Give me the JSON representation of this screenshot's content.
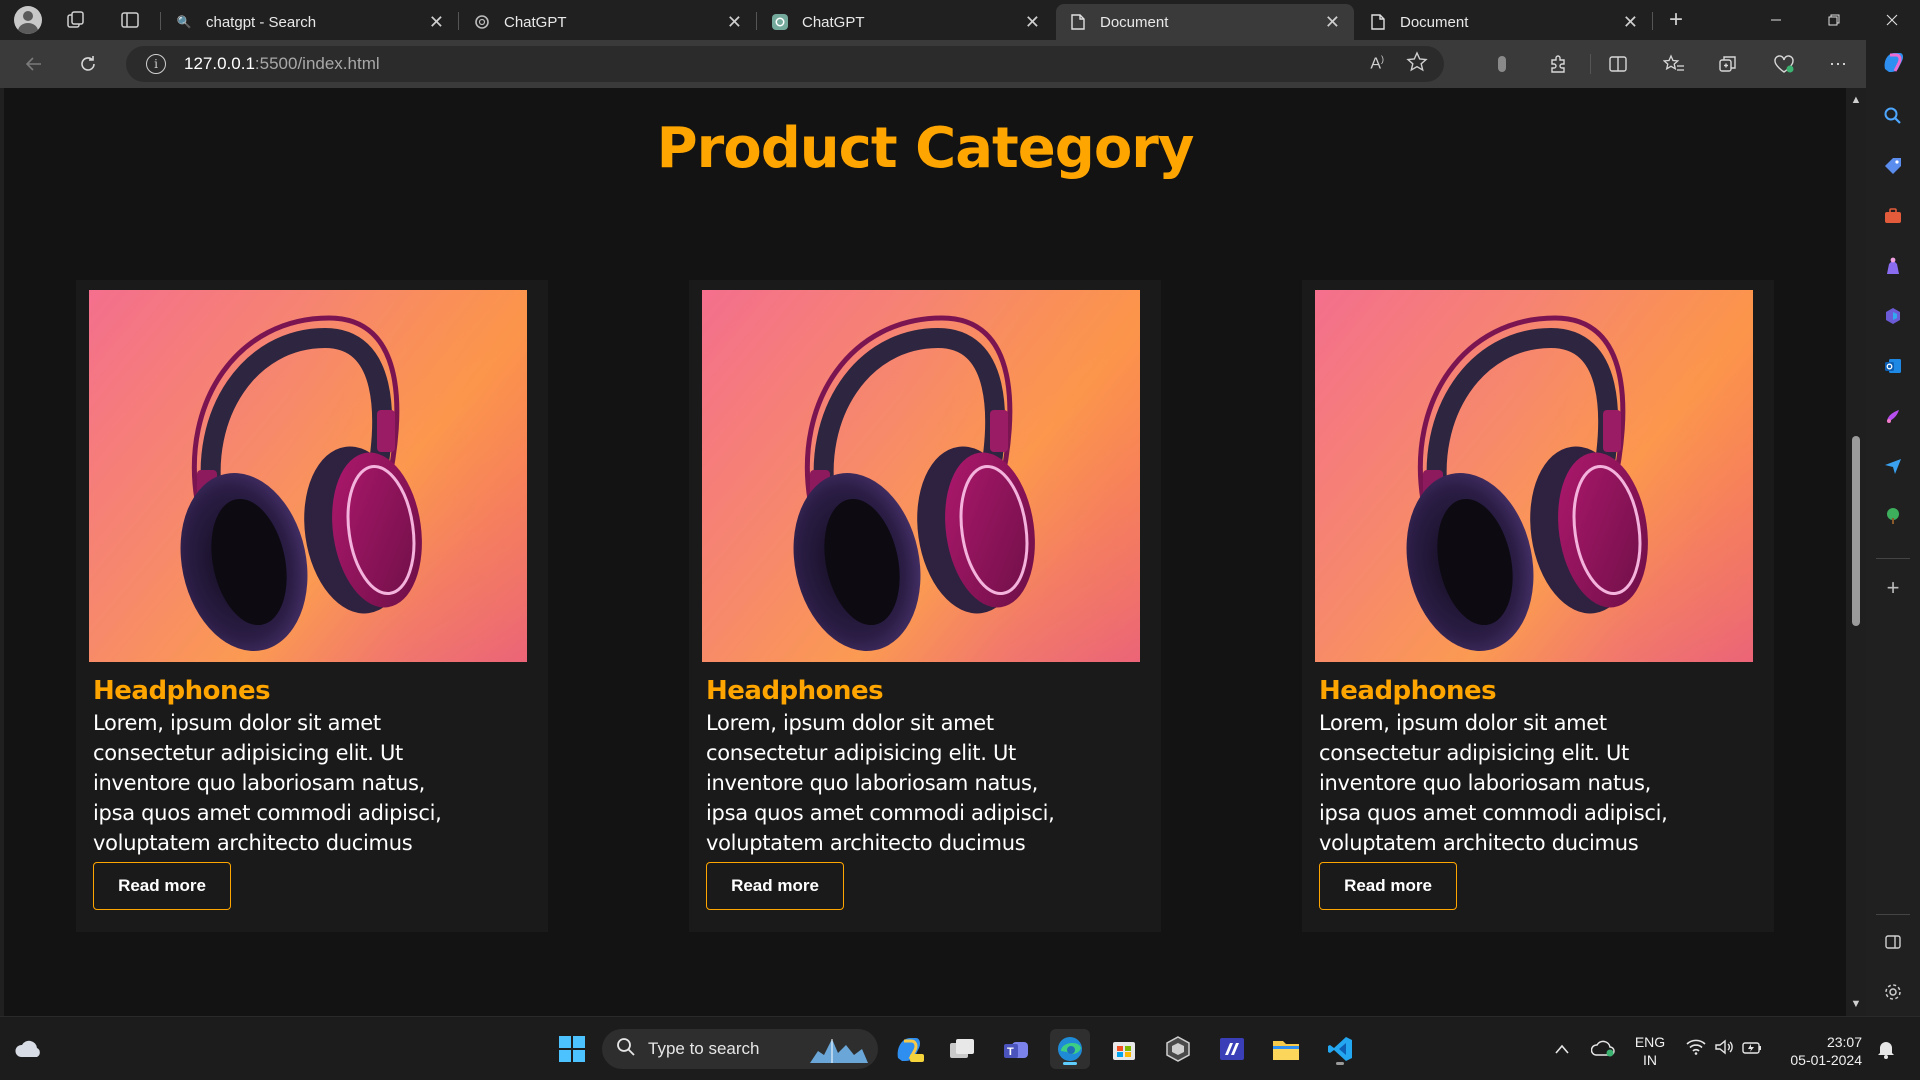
{
  "browser": {
    "tabs": [
      {
        "title": "chatgpt - Search",
        "favicon": "search-icon",
        "active": false
      },
      {
        "title": "ChatGPT",
        "favicon": "openai-icon",
        "active": false
      },
      {
        "title": "ChatGPT",
        "favicon": "openai-icon",
        "active": false
      },
      {
        "title": "Document",
        "favicon": "document-icon",
        "active": true
      },
      {
        "title": "Document",
        "favicon": "document-icon",
        "active": false
      }
    ],
    "new_tab_label": "+",
    "address": {
      "host": "127.0.0.1",
      "path": ":5500/index.html"
    }
  },
  "page": {
    "title": "Product Category",
    "cards": [
      {
        "title": "Headphones",
        "description": "Lorem, ipsum dolor sit amet consectetur adipisicing elit. Ut inventore quo laboriosam natus, ipsa quos amet commodi adipisci, voluptatem architecto ducimus",
        "button": "Read more"
      },
      {
        "title": "Headphones",
        "description": "Lorem, ipsum dolor sit amet consectetur adipisicing elit. Ut inventore quo laboriosam natus, ipsa quos amet commodi adipisci, voluptatem architecto ducimus",
        "button": "Read more"
      },
      {
        "title": "Headphones",
        "description": "Lorem, ipsum dolor sit amet consectetur adipisicing elit. Ut inventore quo laboriosam natus, ipsa quos amet commodi adipisci, voluptatem architecto ducimus",
        "button": "Read more"
      }
    ],
    "accent_color": "#ffa500",
    "background_color": "#131313"
  },
  "taskbar": {
    "search_placeholder": "Type to search",
    "language_line1": "ENG",
    "language_line2": "IN",
    "time": "23:07",
    "date": "05-01-2024"
  }
}
